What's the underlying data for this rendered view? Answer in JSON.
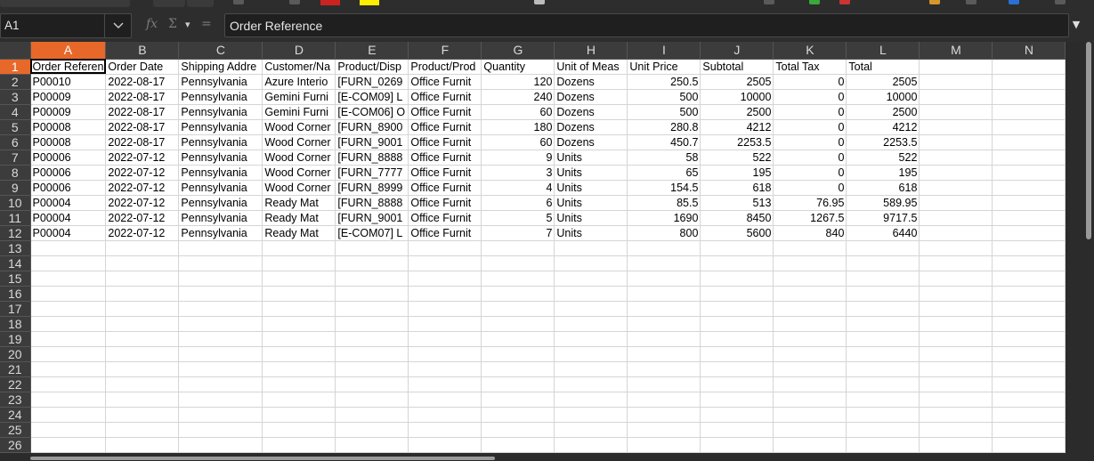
{
  "colors": {
    "accent": "#e8682a",
    "swatch_red": "#cc2222",
    "swatch_yellow": "#ffee00"
  },
  "formula_bar": {
    "cell_ref": "A1",
    "dropdown_icon": "chevron-down-icon",
    "fx_label": "fx",
    "sum_label": "Σ",
    "sum_dropdown_label": "▾",
    "equals_label": "=",
    "formula_value": "Order Reference",
    "expand_label": "▼"
  },
  "sheet": {
    "columns": [
      "A",
      "B",
      "C",
      "D",
      "E",
      "F",
      "G",
      "H",
      "I",
      "J",
      "K",
      "L",
      "M",
      "N"
    ],
    "row_numbers": [
      "1",
      "2",
      "3",
      "4",
      "5",
      "6",
      "7",
      "8",
      "9",
      "10",
      "11",
      "12",
      "13",
      "14",
      "15",
      "16",
      "17",
      "18",
      "19",
      "20",
      "21",
      "22",
      "23",
      "24",
      "25",
      "26"
    ],
    "header": [
      "Order Referen",
      "Order Date",
      "Shipping Addre",
      "Customer/Na",
      "Product/Disp",
      "Product/Prod",
      "Quantity",
      "Unit of Meas",
      "Unit Price",
      "Subtotal",
      "Total Tax",
      "Total",
      "",
      ""
    ],
    "rows": [
      [
        "P00010",
        "2022-08-17",
        "Pennsylvania",
        "Azure Interio",
        "[FURN_0269",
        "Office Furnit",
        "120",
        "Dozens",
        "250.5",
        "2505",
        "0",
        "2505",
        "",
        ""
      ],
      [
        "P00009",
        "2022-08-17",
        "Pennsylvania",
        "Gemini Furni",
        "[E-COM09] L",
        "Office Furnit",
        "240",
        "Dozens",
        "500",
        "10000",
        "0",
        "10000",
        "",
        ""
      ],
      [
        "P00009",
        "2022-08-17",
        "Pennsylvania",
        "Gemini Furni",
        "[E-COM06] O",
        "Office Furnit",
        "60",
        "Dozens",
        "500",
        "2500",
        "0",
        "2500",
        "",
        ""
      ],
      [
        "P00008",
        "2022-08-17",
        "Pennsylvania",
        "Wood Corner",
        "[FURN_8900",
        "Office Furnit",
        "180",
        "Dozens",
        "280.8",
        "4212",
        "0",
        "4212",
        "",
        ""
      ],
      [
        "P00008",
        "2022-08-17",
        "Pennsylvania",
        "Wood Corner",
        "[FURN_9001",
        "Office Furnit",
        "60",
        "Dozens",
        "450.7",
        "2253.5",
        "0",
        "2253.5",
        "",
        ""
      ],
      [
        "P00006",
        "2022-07-12",
        "Pennsylvania",
        "Wood Corner",
        "[FURN_8888",
        "Office Furnit",
        "9",
        "Units",
        "58",
        "522",
        "0",
        "522",
        "",
        ""
      ],
      [
        "P00006",
        "2022-07-12",
        "Pennsylvania",
        "Wood Corner",
        "[FURN_7777",
        "Office Furnit",
        "3",
        "Units",
        "65",
        "195",
        "0",
        "195",
        "",
        ""
      ],
      [
        "P00006",
        "2022-07-12",
        "Pennsylvania",
        "Wood Corner",
        "[FURN_8999",
        "Office Furnit",
        "4",
        "Units",
        "154.5",
        "618",
        "0",
        "618",
        "",
        ""
      ],
      [
        "P00004",
        "2022-07-12",
        "Pennsylvania",
        "Ready Mat",
        "[FURN_8888",
        "Office Furnit",
        "6",
        "Units",
        "85.5",
        "513",
        "76.95",
        "589.95",
        "",
        ""
      ],
      [
        "P00004",
        "2022-07-12",
        "Pennsylvania",
        "Ready Mat",
        "[FURN_9001",
        "Office Furnit",
        "5",
        "Units",
        "1690",
        "8450",
        "1267.5",
        "9717.5",
        "",
        ""
      ],
      [
        "P00004",
        "2022-07-12",
        "Pennsylvania",
        "Ready Mat",
        "[E-COM07] L",
        "Office Furnit",
        "7",
        "Units",
        "800",
        "5600",
        "840",
        "6440",
        "",
        ""
      ]
    ]
  }
}
